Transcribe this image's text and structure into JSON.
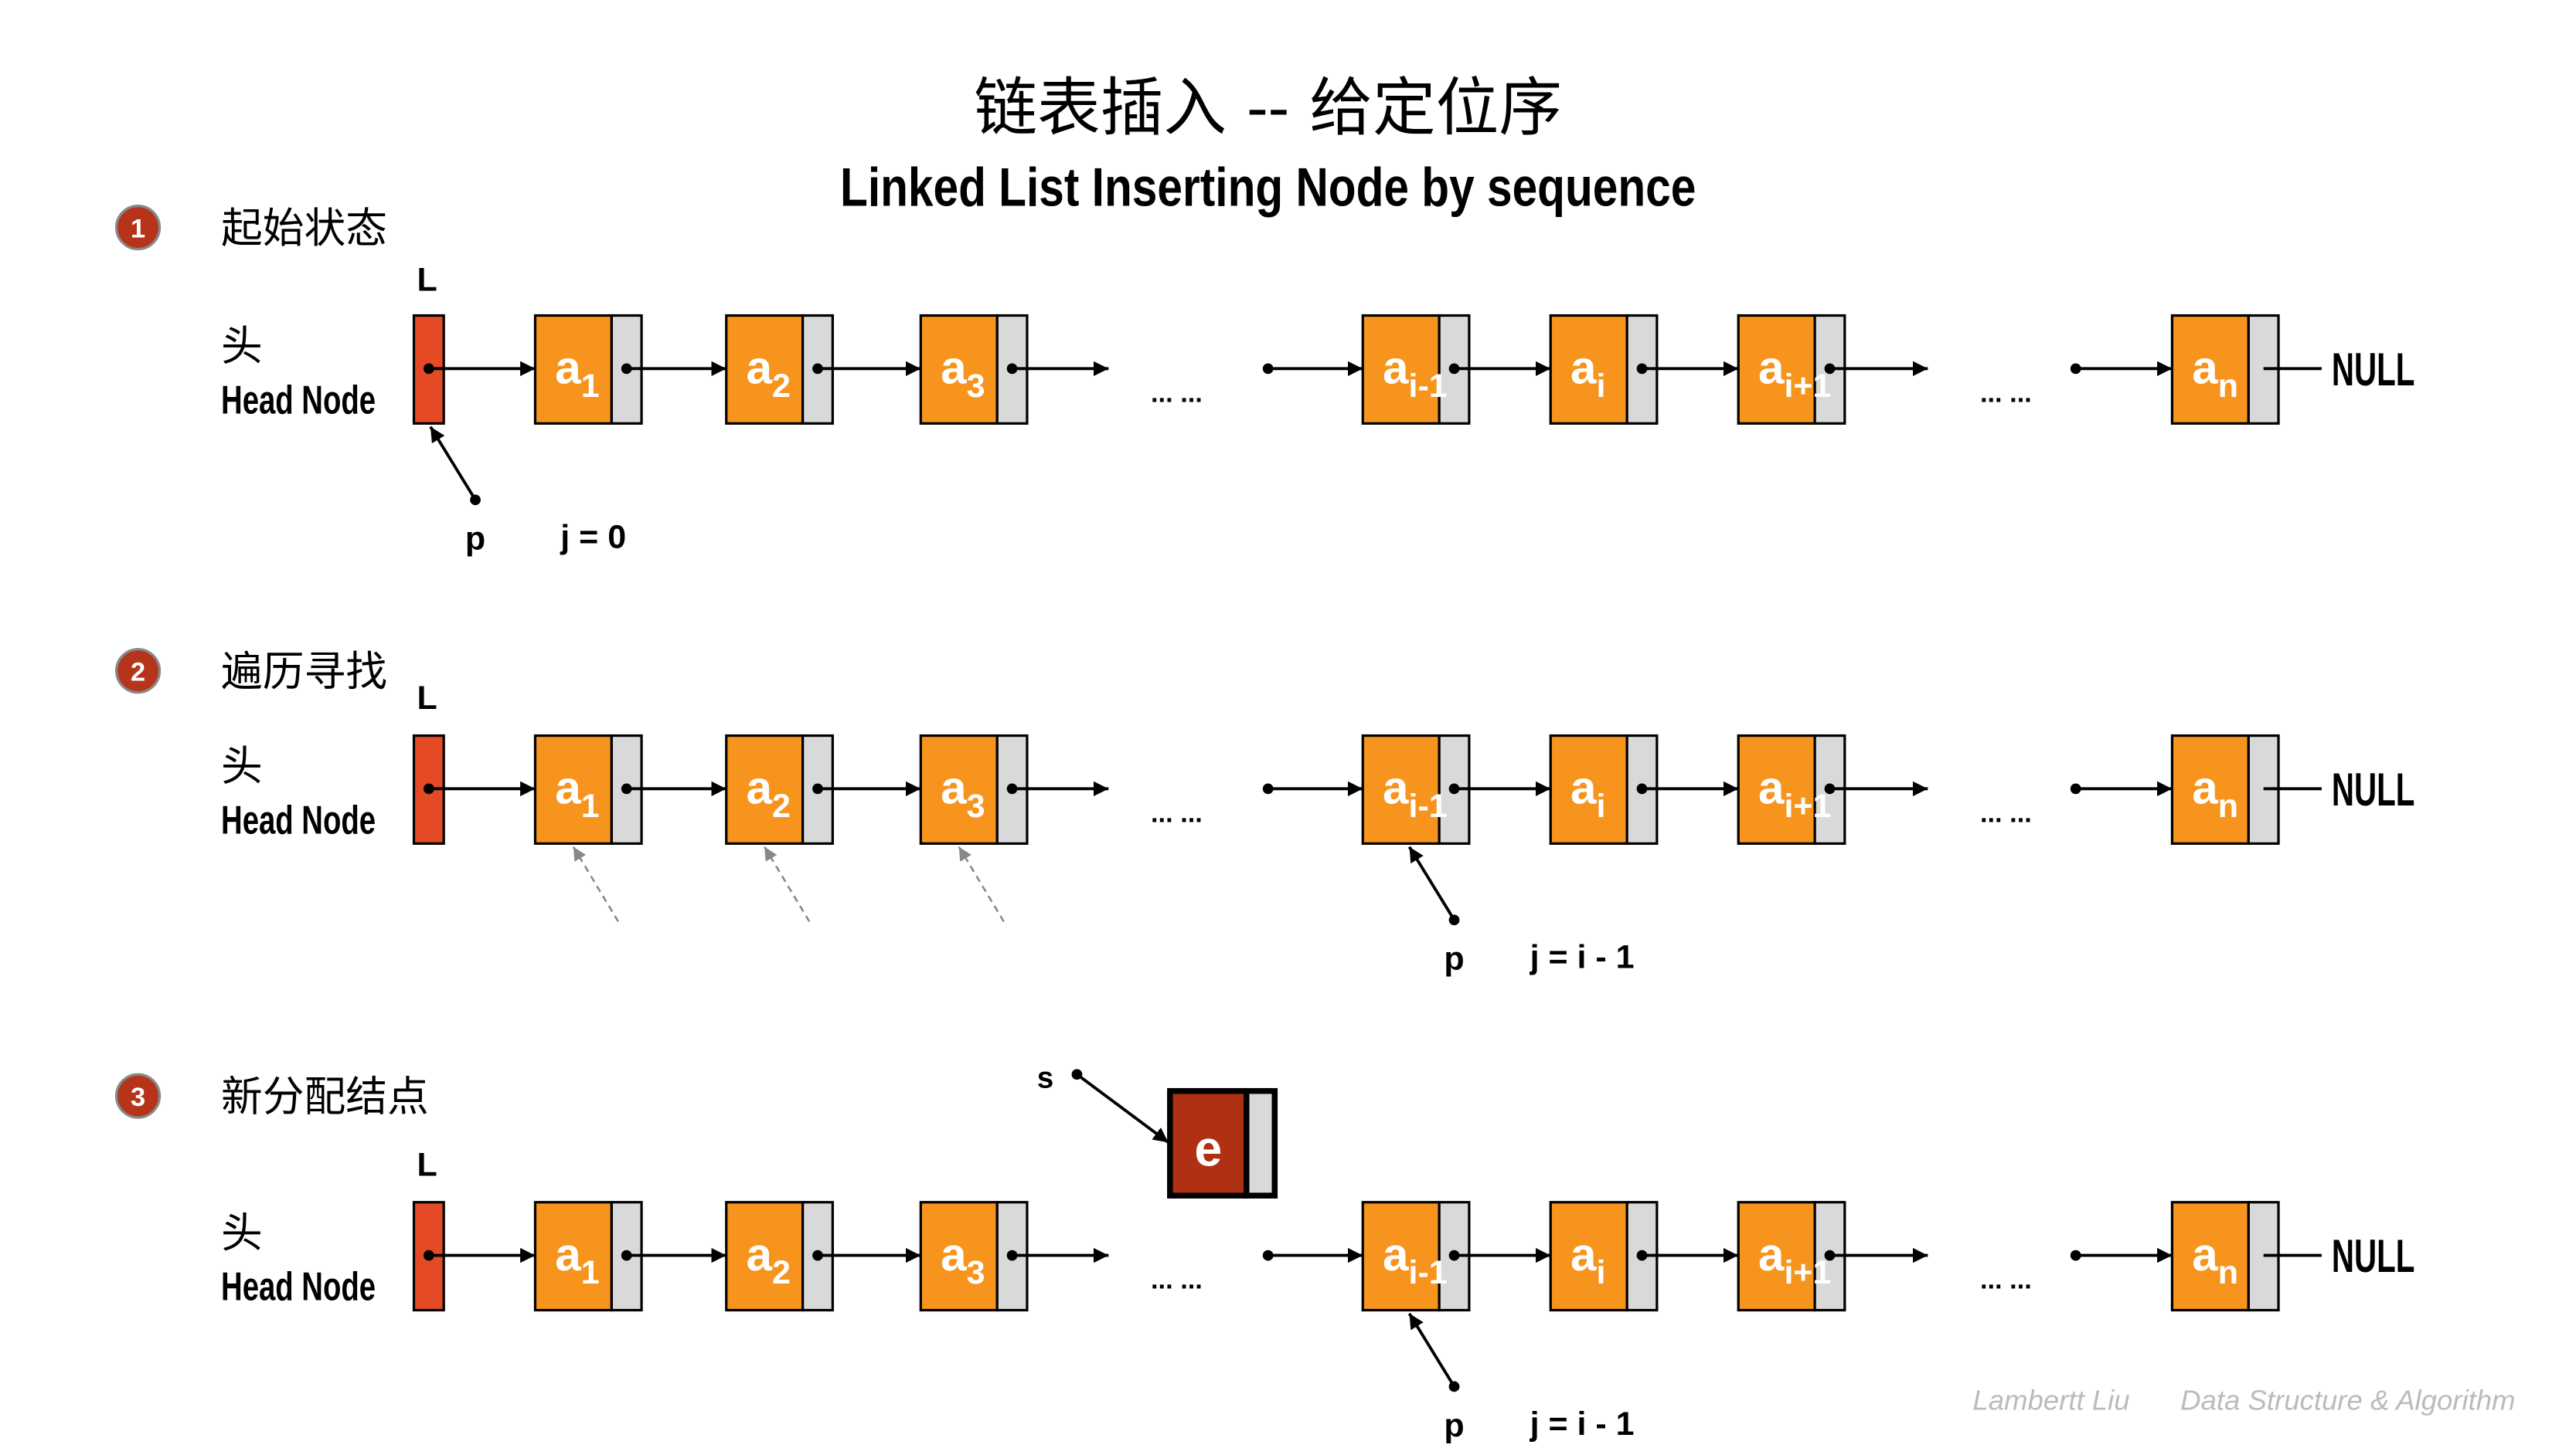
{
  "title": "链表插入 -- 给定位序",
  "subtitle": "Linked List Inserting Node by sequence",
  "watermark_author": "Lambertt Liu",
  "watermark_topic": "Data Structure & Algorithm",
  "colors": {
    "head_node": "#e44a26",
    "data_node": "#f7941d",
    "pointer_field": "#d9d9d9",
    "new_node": "#b03014",
    "step_badge": "#b5341a",
    "watermark": "#bbbbbb"
  },
  "common": {
    "head_pointer_label": "L",
    "head_label_cn": "头",
    "head_label_en": "Head Node",
    "ellipsis": "... ...",
    "null_label": "NULL",
    "pointer_label": "p",
    "nodes": [
      {
        "base": "a",
        "sub": "1"
      },
      {
        "base": "a",
        "sub": "2"
      },
      {
        "base": "a",
        "sub": "3"
      },
      {
        "base": "a",
        "sub": "i-1"
      },
      {
        "base": "a",
        "sub": "i"
      },
      {
        "base": "a",
        "sub": "i+1"
      },
      {
        "base": "a",
        "sub": "n"
      }
    ]
  },
  "steps": [
    {
      "number": "1",
      "label": "起始状态",
      "p_target": "head",
      "counter": "j = 0"
    },
    {
      "number": "2",
      "label": "遍历寻找",
      "p_target": "a_i-1",
      "counter": "j = i - 1",
      "traversal_hints": [
        "a_1",
        "a_2",
        "a_3"
      ]
    },
    {
      "number": "3",
      "label": "新分配结点",
      "p_target": "a_i-1",
      "counter": "j = i - 1",
      "new_node": {
        "pointer_label": "s",
        "value": "e"
      }
    }
  ]
}
